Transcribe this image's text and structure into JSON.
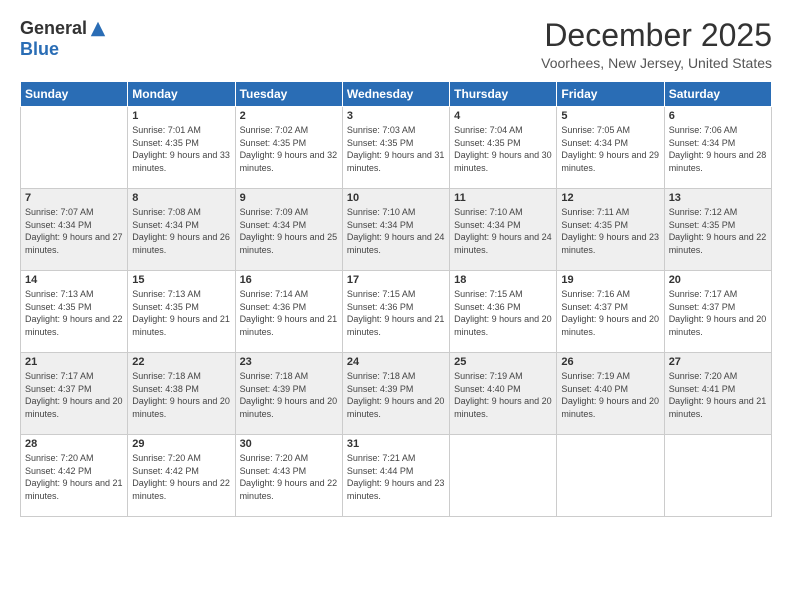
{
  "logo": {
    "general": "General",
    "blue": "Blue"
  },
  "title": "December 2025",
  "location": "Voorhees, New Jersey, United States",
  "weekdays": [
    "Sunday",
    "Monday",
    "Tuesday",
    "Wednesday",
    "Thursday",
    "Friday",
    "Saturday"
  ],
  "weeks": [
    [
      {
        "day": "",
        "sunrise": "",
        "sunset": "",
        "daylight": ""
      },
      {
        "day": "1",
        "sunrise": "Sunrise: 7:01 AM",
        "sunset": "Sunset: 4:35 PM",
        "daylight": "Daylight: 9 hours and 33 minutes."
      },
      {
        "day": "2",
        "sunrise": "Sunrise: 7:02 AM",
        "sunset": "Sunset: 4:35 PM",
        "daylight": "Daylight: 9 hours and 32 minutes."
      },
      {
        "day": "3",
        "sunrise": "Sunrise: 7:03 AM",
        "sunset": "Sunset: 4:35 PM",
        "daylight": "Daylight: 9 hours and 31 minutes."
      },
      {
        "day": "4",
        "sunrise": "Sunrise: 7:04 AM",
        "sunset": "Sunset: 4:35 PM",
        "daylight": "Daylight: 9 hours and 30 minutes."
      },
      {
        "day": "5",
        "sunrise": "Sunrise: 7:05 AM",
        "sunset": "Sunset: 4:34 PM",
        "daylight": "Daylight: 9 hours and 29 minutes."
      },
      {
        "day": "6",
        "sunrise": "Sunrise: 7:06 AM",
        "sunset": "Sunset: 4:34 PM",
        "daylight": "Daylight: 9 hours and 28 minutes."
      }
    ],
    [
      {
        "day": "7",
        "sunrise": "Sunrise: 7:07 AM",
        "sunset": "Sunset: 4:34 PM",
        "daylight": "Daylight: 9 hours and 27 minutes."
      },
      {
        "day": "8",
        "sunrise": "Sunrise: 7:08 AM",
        "sunset": "Sunset: 4:34 PM",
        "daylight": "Daylight: 9 hours and 26 minutes."
      },
      {
        "day": "9",
        "sunrise": "Sunrise: 7:09 AM",
        "sunset": "Sunset: 4:34 PM",
        "daylight": "Daylight: 9 hours and 25 minutes."
      },
      {
        "day": "10",
        "sunrise": "Sunrise: 7:10 AM",
        "sunset": "Sunset: 4:34 PM",
        "daylight": "Daylight: 9 hours and 24 minutes."
      },
      {
        "day": "11",
        "sunrise": "Sunrise: 7:10 AM",
        "sunset": "Sunset: 4:34 PM",
        "daylight": "Daylight: 9 hours and 24 minutes."
      },
      {
        "day": "12",
        "sunrise": "Sunrise: 7:11 AM",
        "sunset": "Sunset: 4:35 PM",
        "daylight": "Daylight: 9 hours and 23 minutes."
      },
      {
        "day": "13",
        "sunrise": "Sunrise: 7:12 AM",
        "sunset": "Sunset: 4:35 PM",
        "daylight": "Daylight: 9 hours and 22 minutes."
      }
    ],
    [
      {
        "day": "14",
        "sunrise": "Sunrise: 7:13 AM",
        "sunset": "Sunset: 4:35 PM",
        "daylight": "Daylight: 9 hours and 22 minutes."
      },
      {
        "day": "15",
        "sunrise": "Sunrise: 7:13 AM",
        "sunset": "Sunset: 4:35 PM",
        "daylight": "Daylight: 9 hours and 21 minutes."
      },
      {
        "day": "16",
        "sunrise": "Sunrise: 7:14 AM",
        "sunset": "Sunset: 4:36 PM",
        "daylight": "Daylight: 9 hours and 21 minutes."
      },
      {
        "day": "17",
        "sunrise": "Sunrise: 7:15 AM",
        "sunset": "Sunset: 4:36 PM",
        "daylight": "Daylight: 9 hours and 21 minutes."
      },
      {
        "day": "18",
        "sunrise": "Sunrise: 7:15 AM",
        "sunset": "Sunset: 4:36 PM",
        "daylight": "Daylight: 9 hours and 20 minutes."
      },
      {
        "day": "19",
        "sunrise": "Sunrise: 7:16 AM",
        "sunset": "Sunset: 4:37 PM",
        "daylight": "Daylight: 9 hours and 20 minutes."
      },
      {
        "day": "20",
        "sunrise": "Sunrise: 7:17 AM",
        "sunset": "Sunset: 4:37 PM",
        "daylight": "Daylight: 9 hours and 20 minutes."
      }
    ],
    [
      {
        "day": "21",
        "sunrise": "Sunrise: 7:17 AM",
        "sunset": "Sunset: 4:37 PM",
        "daylight": "Daylight: 9 hours and 20 minutes."
      },
      {
        "day": "22",
        "sunrise": "Sunrise: 7:18 AM",
        "sunset": "Sunset: 4:38 PM",
        "daylight": "Daylight: 9 hours and 20 minutes."
      },
      {
        "day": "23",
        "sunrise": "Sunrise: 7:18 AM",
        "sunset": "Sunset: 4:39 PM",
        "daylight": "Daylight: 9 hours and 20 minutes."
      },
      {
        "day": "24",
        "sunrise": "Sunrise: 7:18 AM",
        "sunset": "Sunset: 4:39 PM",
        "daylight": "Daylight: 9 hours and 20 minutes."
      },
      {
        "day": "25",
        "sunrise": "Sunrise: 7:19 AM",
        "sunset": "Sunset: 4:40 PM",
        "daylight": "Daylight: 9 hours and 20 minutes."
      },
      {
        "day": "26",
        "sunrise": "Sunrise: 7:19 AM",
        "sunset": "Sunset: 4:40 PM",
        "daylight": "Daylight: 9 hours and 20 minutes."
      },
      {
        "day": "27",
        "sunrise": "Sunrise: 7:20 AM",
        "sunset": "Sunset: 4:41 PM",
        "daylight": "Daylight: 9 hours and 21 minutes."
      }
    ],
    [
      {
        "day": "28",
        "sunrise": "Sunrise: 7:20 AM",
        "sunset": "Sunset: 4:42 PM",
        "daylight": "Daylight: 9 hours and 21 minutes."
      },
      {
        "day": "29",
        "sunrise": "Sunrise: 7:20 AM",
        "sunset": "Sunset: 4:42 PM",
        "daylight": "Daylight: 9 hours and 22 minutes."
      },
      {
        "day": "30",
        "sunrise": "Sunrise: 7:20 AM",
        "sunset": "Sunset: 4:43 PM",
        "daylight": "Daylight: 9 hours and 22 minutes."
      },
      {
        "day": "31",
        "sunrise": "Sunrise: 7:21 AM",
        "sunset": "Sunset: 4:44 PM",
        "daylight": "Daylight: 9 hours and 23 minutes."
      },
      {
        "day": "",
        "sunrise": "",
        "sunset": "",
        "daylight": ""
      },
      {
        "day": "",
        "sunrise": "",
        "sunset": "",
        "daylight": ""
      },
      {
        "day": "",
        "sunrise": "",
        "sunset": "",
        "daylight": ""
      }
    ]
  ]
}
